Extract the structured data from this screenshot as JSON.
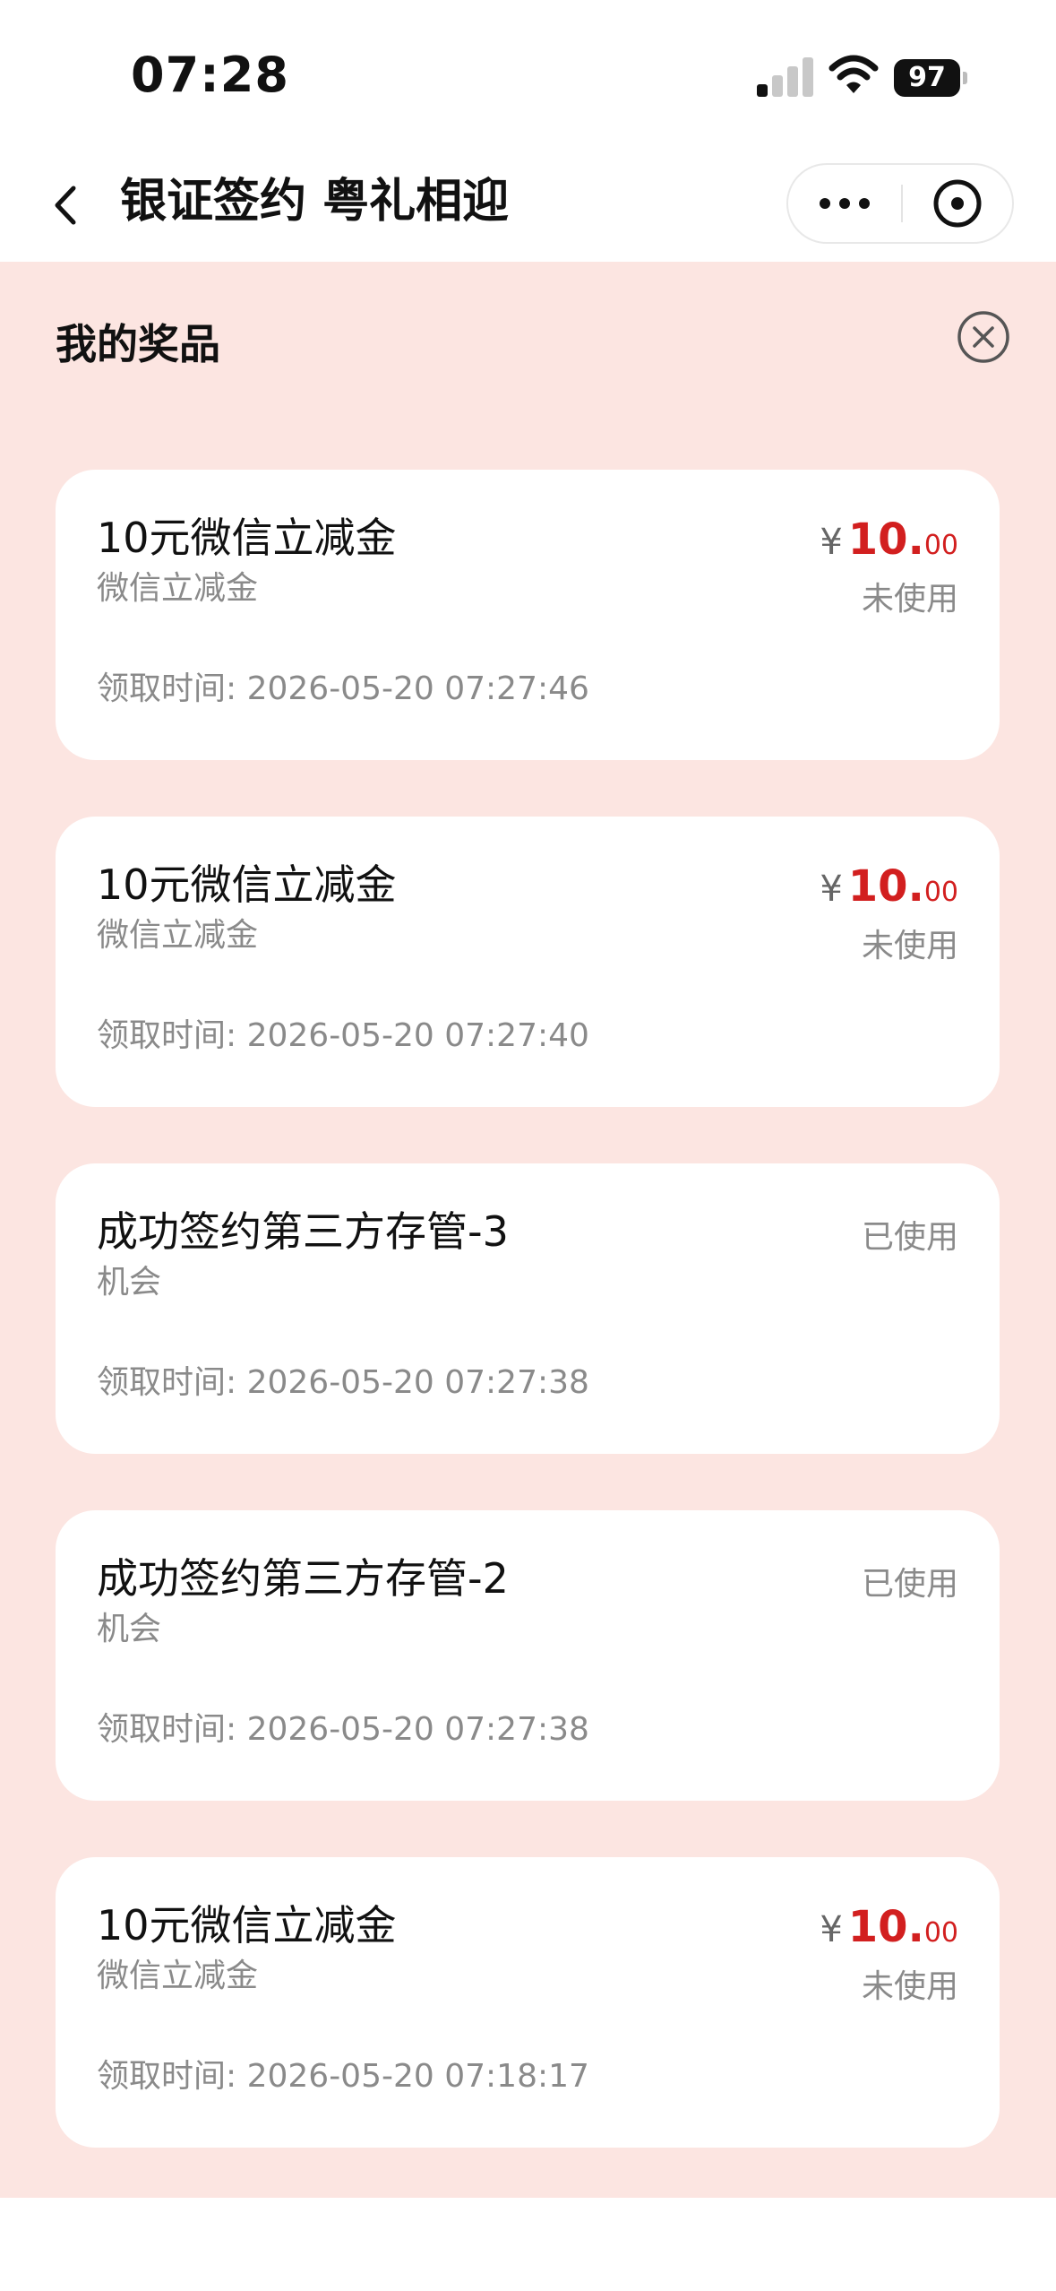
{
  "status_bar": {
    "time": "07:28",
    "battery": "97"
  },
  "nav": {
    "title": "银证签约 粤礼相迎"
  },
  "panel": {
    "title": "我的奖品"
  },
  "prizes": [
    {
      "title": "10元微信立减金",
      "subtitle": "微信立减金",
      "currency": "¥",
      "amount_int": "10.",
      "amount_dec": "00",
      "status": "未使用",
      "time": "领取时间: 2026-05-20 07:27:46"
    },
    {
      "title": "10元微信立减金",
      "subtitle": "微信立减金",
      "currency": "¥",
      "amount_int": "10.",
      "amount_dec": "00",
      "status": "未使用",
      "time": "领取时间: 2026-05-20 07:27:40"
    },
    {
      "title": "成功签约第三方存管-3",
      "subtitle": "机会",
      "status": "已使用",
      "time": "领取时间: 2026-05-20 07:27:38"
    },
    {
      "title": "成功签约第三方存管-2",
      "subtitle": "机会",
      "status": "已使用",
      "time": "领取时间: 2026-05-20 07:27:38"
    },
    {
      "title": "10元微信立减金",
      "subtitle": "微信立减金",
      "currency": "¥",
      "amount_int": "10.",
      "amount_dec": "00",
      "status": "未使用",
      "time": "领取时间: 2026-05-20 07:18:17"
    }
  ],
  "colors": {
    "panel_background": "#fce5e1",
    "amount_red": "#d21f1f",
    "muted_text": "#8a8a8a"
  },
  "icons": {
    "back": "chevron-left-icon",
    "more": "more-dots-icon",
    "close": "close-circle-icon",
    "signal": "cellular-signal-icon",
    "wifi": "wifi-icon",
    "battery": "battery-icon"
  }
}
